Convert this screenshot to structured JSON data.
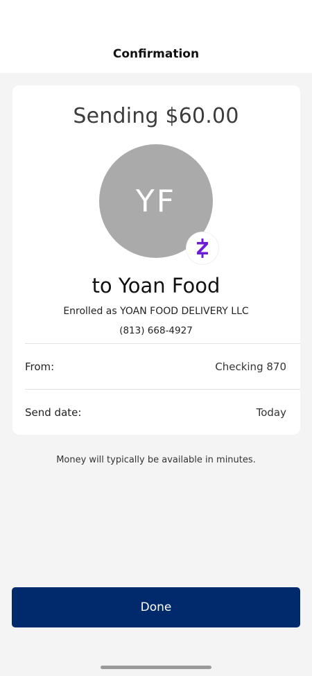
{
  "header": {
    "title": "Confirmation"
  },
  "payment": {
    "sending_text": "Sending $60.00",
    "avatar_initials": "YF",
    "recipient_text": "to Yoan Food",
    "enrolled_text": "Enrolled as YOAN FOOD DELIVERY LLC",
    "phone": "(813) 668-4927",
    "badge_icon": "zelle-icon",
    "badge_color": "#6d1ed4"
  },
  "details": {
    "from_label": "From:",
    "from_value": "Checking 870",
    "date_label": "Send date:",
    "date_value": "Today"
  },
  "note": "Money will typically be available in minutes.",
  "actions": {
    "done_label": "Done",
    "done_color": "#012a6d"
  }
}
